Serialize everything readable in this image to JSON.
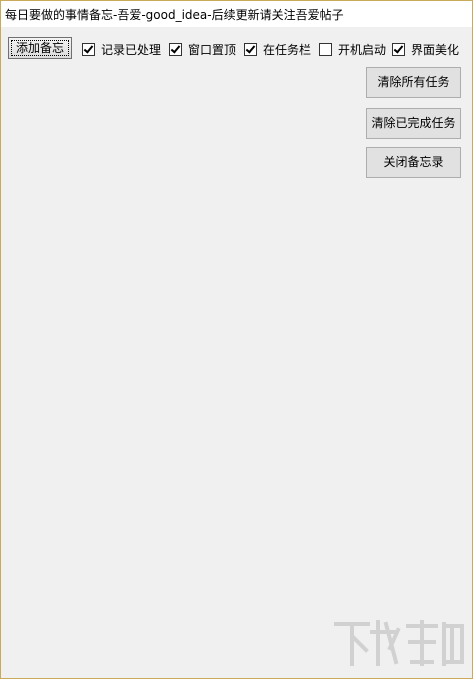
{
  "window": {
    "title": "每日要做的事情备忘-吾爱-good_idea-后续更新请关注吾爱帖子"
  },
  "toolbar": {
    "add_button": "添加备忘",
    "checkboxes": [
      {
        "label": "记录已处理",
        "checked": true
      },
      {
        "label": "窗口置顶",
        "checked": true
      },
      {
        "label": "在任务栏",
        "checked": true
      },
      {
        "label": "开机启动",
        "checked": false
      },
      {
        "label": "界面美化",
        "checked": true
      }
    ]
  },
  "side_buttons": {
    "clear_all": "清除所有任务",
    "clear_completed": "清除已完成任务",
    "close_memo": "关闭备忘录"
  },
  "colors": {
    "frame_border": "#c9a95a",
    "background": "#f0f0f0"
  }
}
